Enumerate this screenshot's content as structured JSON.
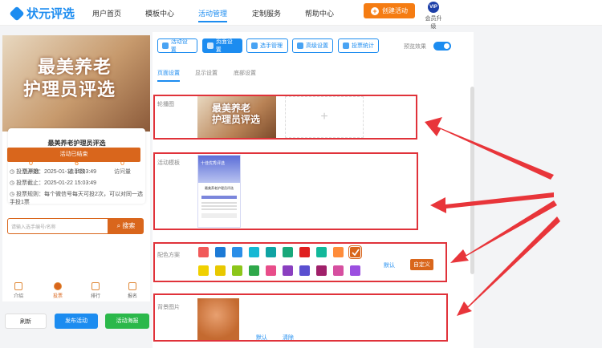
{
  "header": {
    "logo_text": "状元评选",
    "nav": [
      "用户首页",
      "模板中心",
      "活动管理",
      "定制服务",
      "帮助中心"
    ],
    "active_nav": "活动管理",
    "create_label": "创建活动",
    "vip_badge": "VIP",
    "vip_label": "会员升级"
  },
  "preview": {
    "banner_line1": "最美养老",
    "banner_line2": "护理员评选",
    "title": "最美养老护理员评选",
    "stats": [
      {
        "value": "0",
        "label": "总票数"
      },
      {
        "value": "6",
        "label": "选手数"
      },
      {
        "value": "0",
        "label": "访问量"
      }
    ],
    "status": "活动已结束",
    "start": "投票开始：2025-01-16 15:03:49",
    "end": "投票截止：2025-01-22 15:03:49",
    "rule": "投票规则：每个微信号每天可投2次，可以对同一选手投1票",
    "search_placeholder": "请输入选手编号/名称",
    "search_button": "搜索",
    "bottom_nav": [
      "介绍",
      "投票",
      "排行",
      "报名"
    ],
    "active_bottom": "投票"
  },
  "actions": {
    "refresh": "刷新",
    "publish": "发布活动",
    "poster": "活动海报"
  },
  "toolbar": {
    "items": [
      "活动设置",
      "页面设置",
      "选手管理",
      "高级设置",
      "投票统计"
    ],
    "active": "页面设置",
    "preview_label": "预览效果",
    "preview_on": true
  },
  "subtabs": {
    "items": [
      "页面设置",
      "显示设置",
      "底部设置"
    ],
    "active": "页面设置"
  },
  "sections": {
    "carousel": "轮播图",
    "template": "活动模板",
    "color": "配色方案",
    "bg": "背景图片",
    "default": "默认",
    "custom": "自定义",
    "clear": "清除",
    "plus": "+"
  },
  "template_thumb": {
    "title": "十佳优秀评选",
    "subtitle": "最美养老护理员评选"
  },
  "colors": {
    "row1": [
      "#f15a5a",
      "#1c7ad6",
      "#2a8ee8",
      "#16b8d4",
      "#0fa3a3",
      "#19a87a",
      "#e02020",
      "#12b89a",
      "#ff8c3a",
      "#d9661c"
    ],
    "row2": [
      "#f0d000",
      "#e8c800",
      "#8cc61a",
      "#2fa84a",
      "#e84d8a",
      "#8a3fc0",
      "#5a4fd0",
      "#a0206a",
      "#d64fa0",
      "#9b4fe0"
    ],
    "selected": "#d9661c",
    "annotation": "#e0323a",
    "accent": "#1c8cf0"
  }
}
